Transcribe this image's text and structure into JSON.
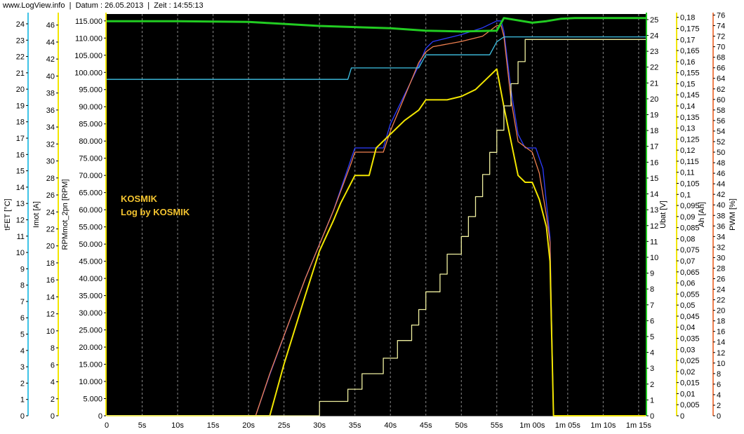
{
  "header": {
    "site": "www.LogView.info",
    "datum": "Datum : 26.05.2013",
    "zeit": "Zeit : 14:55:13"
  },
  "annotations": [
    "KOSMIK",
    "Log by KOSMIK"
  ],
  "colors": {
    "plot_bg": "#000000",
    "grid": "#8a8a8a",
    "tfet": "#3fc3e6",
    "imot": "#f2e600",
    "rpm": "#f2e600",
    "ubat": "#22cc22",
    "ah": "#f2e600",
    "pwm": "#f08050",
    "rpm_ref": "#2c3cff",
    "ah_line": "#f0f0a0",
    "annot": "#f4c430"
  },
  "chart_data": {
    "type": "line",
    "x_ticks": [
      "0",
      "5s",
      "10s",
      "15s",
      "20s",
      "25s",
      "30s",
      "35s",
      "40s",
      "45s",
      "50s",
      "55s",
      "1m 00s",
      "1m 05s",
      "1m 10s",
      "1m 15s"
    ],
    "xlim": [
      0,
      76
    ],
    "axes": {
      "tfet": {
        "label": "tFET [°C]",
        "ticks": [
          "0",
          "1",
          "2",
          "3",
          "4",
          "5",
          "6",
          "7",
          "8",
          "9",
          "10",
          "11",
          "12",
          "13",
          "14",
          "15",
          "16",
          "17",
          "18",
          "19",
          "20",
          "21",
          "22",
          "23",
          "24"
        ],
        "range": [
          0,
          24.6
        ]
      },
      "imot": {
        "label": "Imot [A]",
        "ticks": [
          "0",
          "2",
          "4",
          "6",
          "8",
          "10",
          "12",
          "14",
          "16",
          "18",
          "20",
          "22",
          "24",
          "26",
          "28",
          "30",
          "32",
          "34",
          "36",
          "38",
          "40",
          "42",
          "44",
          "46"
        ],
        "range": [
          0,
          47.3
        ]
      },
      "rpm": {
        "label": "RPMmot_2pn [RPM]",
        "ticks": [
          "0",
          "5.000",
          "10.000",
          "15.000",
          "20.000",
          "25.000",
          "30.000",
          "35.000",
          "40.000",
          "45.000",
          "50.000",
          "55.000",
          "60.000",
          "65.000",
          "70.000",
          "75.000",
          "80.000",
          "85.000",
          "90.000",
          "95.000",
          "100.000",
          "105.000",
          "110.000",
          "115.000"
        ],
        "range": [
          0,
          117000
        ]
      },
      "ubat": {
        "label": "Ubat [V]",
        "ticks": [
          "0",
          "1",
          "2",
          "3",
          "4",
          "5",
          "6",
          "7",
          "8",
          "9",
          "10",
          "11",
          "12",
          "13",
          "14",
          "15",
          "16",
          "17",
          "18",
          "19",
          "20",
          "21",
          "22",
          "23",
          "24",
          "25"
        ],
        "range": [
          0,
          25.35
        ]
      },
      "ah": {
        "label": "Ah [Ah]",
        "ticks": [
          "0",
          "0,005",
          "0,01",
          "0,015",
          "0,02",
          "0,025",
          "0,03",
          "0,035",
          "0,04",
          "0,045",
          "0,05",
          "0,055",
          "0,06",
          "0,065",
          "0,07",
          "0,075",
          "0,08",
          "0,085",
          "0,09",
          "0,095",
          "0,1",
          "0,105",
          "0,11",
          "0,115",
          "0,12",
          "0,125",
          "0,13",
          "0,135",
          "0,14",
          "0,145",
          "0,15",
          "0,155",
          "0,16",
          "0,165",
          "0,17",
          "0,175",
          "0,18"
        ],
        "range": [
          0,
          0.1815
        ]
      },
      "pwm": {
        "label": "PWM [%]",
        "ticks": [
          "0",
          "2",
          "4",
          "6",
          "8",
          "10",
          "12",
          "14",
          "16",
          "18",
          "20",
          "22",
          "24",
          "26",
          "28",
          "30",
          "32",
          "34",
          "36",
          "38",
          "40",
          "42",
          "44",
          "46",
          "48",
          "50",
          "52",
          "54",
          "56",
          "58",
          "60",
          "62",
          "64",
          "66",
          "68",
          "70",
          "72",
          "74",
          "76"
        ],
        "range": [
          0,
          76.2
        ]
      }
    },
    "series": [
      {
        "key": "rpm_ref",
        "axis": "rpm",
        "x": [
          0,
          21,
          23,
          28,
          32,
          34.5,
          35,
          35.5,
          39,
          40,
          44,
          45,
          46,
          50,
          53,
          54,
          55,
          55.6,
          56,
          57,
          58,
          59,
          60,
          60.5,
          61,
          61.5,
          62,
          62.5,
          63
        ],
        "y": [
          0,
          0,
          12000,
          40000,
          60000,
          75000,
          78000,
          78000,
          78000,
          85000,
          102000,
          107000,
          109000,
          111000,
          113000,
          114000,
          115000,
          115000,
          112000,
          95000,
          82000,
          78000,
          78000,
          78000,
          75000,
          72000,
          62000,
          52000,
          0
        ]
      },
      {
        "key": "pwm",
        "axis": "pwm",
        "x": [
          0,
          21,
          23,
          28,
          32,
          34.5,
          35,
          39,
          40,
          44,
          45,
          46,
          50,
          53,
          55,
          55.6,
          56,
          57,
          58,
          60,
          61,
          62,
          62.5,
          63,
          76
        ],
        "y": [
          0,
          0,
          8,
          26,
          39,
          48,
          50,
          50,
          54,
          67,
          69,
          70,
          71,
          72,
          74,
          74,
          72,
          60,
          52,
          50,
          46,
          38,
          33,
          0,
          0
        ]
      },
      {
        "key": "rpm",
        "axis": "rpm",
        "x": [
          0,
          23,
          25,
          28,
          30,
          32,
          33,
          34,
          35,
          36,
          37,
          38,
          39,
          40,
          42,
          44,
          45,
          46,
          48,
          50,
          52,
          54,
          55,
          56,
          57,
          58,
          59,
          60,
          61,
          62,
          62.5,
          63,
          76
        ],
        "y": [
          0,
          0,
          15000,
          35000,
          48000,
          57000,
          62000,
          66000,
          70000,
          70000,
          70000,
          78000,
          80000,
          82000,
          86000,
          89000,
          92000,
          92000,
          92000,
          93000,
          95000,
          99000,
          101000,
          90000,
          80000,
          70000,
          68000,
          68000,
          63000,
          55000,
          45000,
          0,
          0
        ]
      },
      {
        "key": "ubat",
        "axis": "ubat",
        "x": [
          0,
          10,
          20,
          22,
          30,
          40,
          45,
          50,
          55,
          56,
          60,
          62,
          64,
          66,
          76
        ],
        "y": [
          24.9,
          24.9,
          24.85,
          24.8,
          24.6,
          24.45,
          24.3,
          24.25,
          24.3,
          25.1,
          24.8,
          24.9,
          25.05,
          25.1,
          25.1
        ]
      },
      {
        "key": "tfet",
        "axis": "tfet",
        "x": [
          0,
          15,
          22,
          34,
          34.5,
          40,
          43,
          44,
          45,
          47,
          48,
          54,
          55,
          56,
          60,
          63,
          76
        ],
        "y": [
          20.6,
          20.6,
          20.6,
          20.6,
          21.3,
          21.3,
          21.3,
          21.3,
          22.1,
          22.1,
          22.1,
          22.1,
          22.9,
          23.2,
          23.2,
          23.2,
          23.2
        ]
      },
      {
        "key": "ah_line",
        "axis": "ah",
        "x": [
          0,
          30,
          30,
          34,
          34,
          36,
          36,
          39,
          39,
          41,
          41,
          43,
          43,
          44,
          44,
          45,
          45,
          47,
          47,
          48,
          48,
          50,
          50,
          51,
          51,
          52,
          52,
          53,
          53,
          54,
          54,
          55,
          55,
          56,
          56,
          57,
          57,
          58,
          58,
          59,
          59,
          76
        ],
        "y": [
          0,
          0,
          0.0065,
          0.0065,
          0.012,
          0.012,
          0.019,
          0.019,
          0.026,
          0.026,
          0.034,
          0.034,
          0.041,
          0.041,
          0.048,
          0.048,
          0.056,
          0.056,
          0.064,
          0.064,
          0.073,
          0.073,
          0.081,
          0.081,
          0.09,
          0.09,
          0.099,
          0.099,
          0.109,
          0.109,
          0.119,
          0.119,
          0.129,
          0.129,
          0.14,
          0.14,
          0.15,
          0.15,
          0.16,
          0.16,
          0.17,
          0.17
        ]
      }
    ]
  }
}
